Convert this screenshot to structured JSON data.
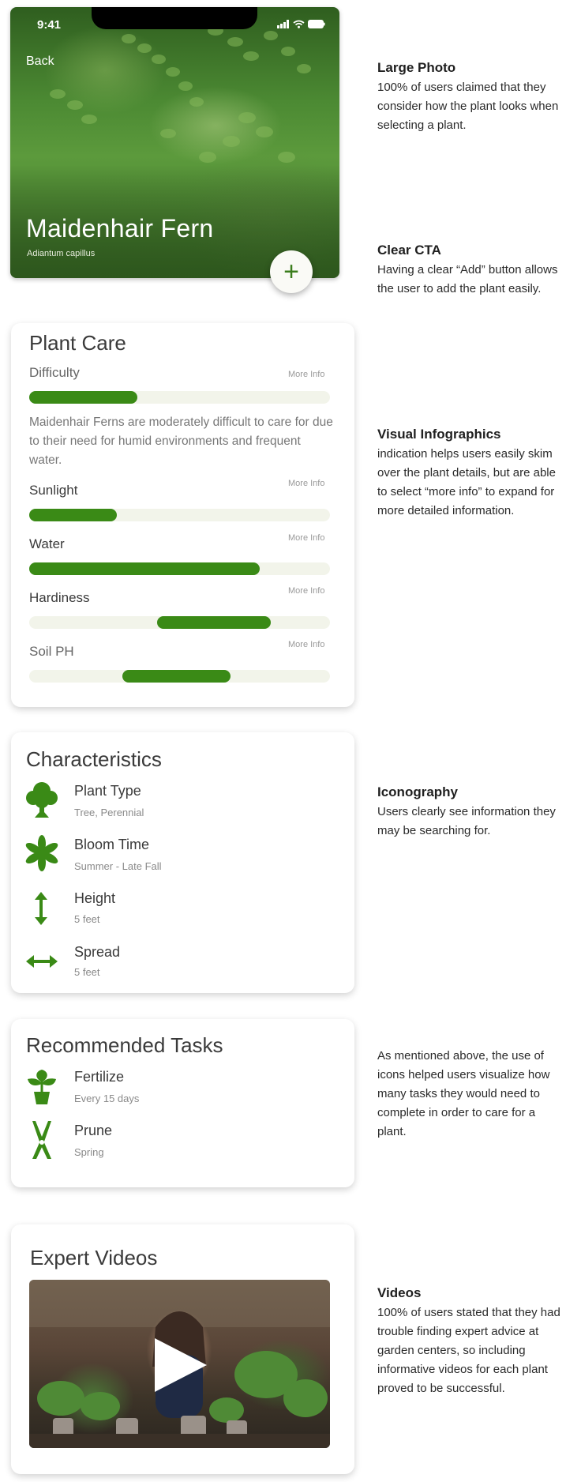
{
  "hero": {
    "time": "9:41",
    "back": "Back",
    "title": "Maidenhair Fern",
    "subtitle": "Adiantum capillus",
    "add": "+"
  },
  "plant_care": {
    "title": "Plant Care",
    "more_info": "More Info",
    "difficulty": {
      "label": "Difficulty",
      "level": 0.36
    },
    "description": "Maidenhair Ferns are moderately difficult to care for due to their need for humid environments and frequent water.",
    "sunlight": {
      "label": "Sunlight",
      "level": 0.29
    },
    "water": {
      "label": "Water",
      "level": 0.77
    },
    "hardiness": {
      "label": "Hardiness",
      "range": [
        0.425,
        0.805
      ]
    },
    "soil_ph": {
      "label": "Soil PH",
      "range": [
        0.31,
        0.67
      ]
    }
  },
  "characteristics": {
    "title": "Characteristics",
    "items": [
      {
        "name": "Plant Type",
        "value": "Tree, Perennial",
        "icon": "tree-icon"
      },
      {
        "name": "Bloom Time",
        "value": "Summer - Late Fall",
        "icon": "flower-icon"
      },
      {
        "name": "Height",
        "value": "5 feet",
        "icon": "vertical-arrow-icon"
      },
      {
        "name": "Spread",
        "value": "5 feet",
        "icon": "horizontal-arrow-icon"
      }
    ]
  },
  "tasks": {
    "title": "Recommended Tasks",
    "items": [
      {
        "name": "Fertilize",
        "value": "Every 15 days",
        "icon": "potted-plant-icon"
      },
      {
        "name": "Prune",
        "value": "Spring",
        "icon": "pruning-shears-icon"
      }
    ]
  },
  "videos": {
    "title": "Expert Videos"
  },
  "notes": {
    "large_photo": {
      "title": "Large Photo",
      "text": "100% of users claimed that they consider how the plant looks when selecting a plant."
    },
    "clear_cta": {
      "title": "Clear CTA",
      "text": "Having a clear “Add” button allows the user to add the plant easily."
    },
    "infographics": {
      "title": "Visual Infographics",
      "text": "indication helps users easily skim over the plant details, but are able to select “more info” to expand for more detailed information."
    },
    "iconography": {
      "title": "Iconography",
      "text": "Users clearly see information they may be searching for."
    },
    "tasks_note": {
      "text": "As mentioned above, the use of icons helped users visualize how many tasks they would need to complete in order to care for a plant."
    },
    "videos_note": {
      "title": "Videos",
      "text": "100% of users stated that they had trouble finding expert advice at garden centers, so including informative videos for each plant proved to be successful."
    }
  },
  "colors": {
    "accent": "#3a8a16",
    "track": "#f2f4ea"
  }
}
